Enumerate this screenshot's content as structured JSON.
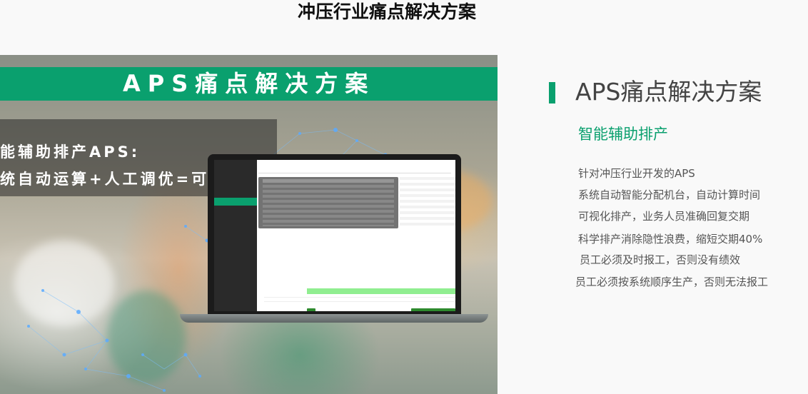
{
  "page": {
    "title": "冲压行业痛点解决方案"
  },
  "banner": {
    "band_title": "APS痛点解决方案",
    "line1": "能辅助排产APS:",
    "line2": "统自动运算+人工调优=可落地。"
  },
  "right": {
    "heading": "APS痛点解决方案",
    "subheading": "智能辅助排产",
    "lines": [
      "针对冲压行业开发的APS",
      "系统自动智能分配机台，自动计算时间",
      "可视化排产，业务人员准确回复交期",
      "科学排产消除隐性浪费，缩短交期40%",
      "员工必须及时报工，否则没有绩效",
      "员工必须按系统顺序生产，否则无法报工"
    ]
  },
  "colors": {
    "brand_green": "#0aa06e",
    "heading_gray": "#444444",
    "body_gray": "#555555"
  }
}
